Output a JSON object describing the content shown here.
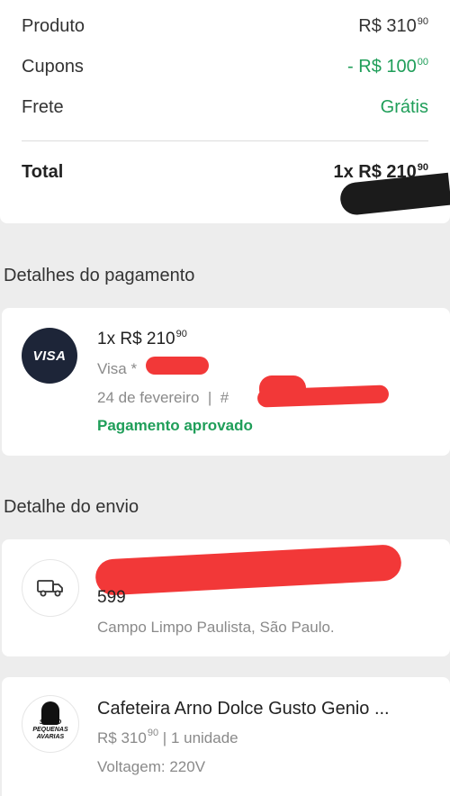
{
  "summary": {
    "product_label": "Produto",
    "product_value": "R$ 310",
    "product_cents": "90",
    "coupons_label": "Cupons",
    "coupons_value": "- R$ 100",
    "coupons_cents": "00",
    "shipping_label": "Frete",
    "shipping_value": "Grátis",
    "total_label": "Total",
    "total_value": "1x R$ 210",
    "total_cents": "90"
  },
  "payment": {
    "section_title": "Detalhes do pagamento",
    "card_brand": "VISA",
    "amount": "1x R$ 210",
    "amount_cents": "90",
    "card_label": "Visa *",
    "date": "24 de fevereiro  |  #",
    "status": "Pagamento aprovado"
  },
  "shipping": {
    "section_title": "Detalhe do envio",
    "address_number": "599",
    "city": "Campo Limpo Paulista, São Paulo."
  },
  "product": {
    "title": "Cafeteira Arno Dolce Gusto Genio ...",
    "price": "R$ 310",
    "price_cents": "90",
    "quantity": " | 1 unidade",
    "voltage": "Voltagem: 220V",
    "thumb_text": "SALDO PEQUENAS AVARIAS"
  },
  "colors": {
    "green": "#1f9e59",
    "visa_bg": "#1d2538",
    "redaction": "#f23838"
  }
}
